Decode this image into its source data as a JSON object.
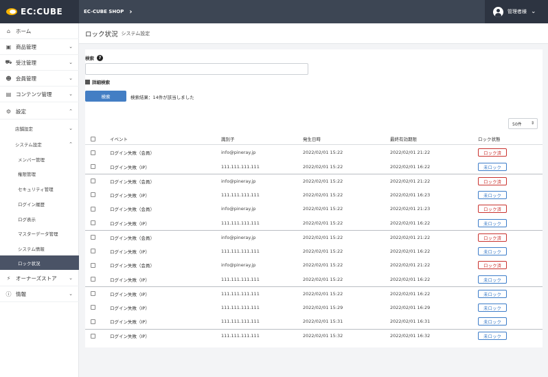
{
  "header": {
    "logo": "EC:CUBE",
    "shop_name": "EC-CUBE SHOP",
    "user_name": "管理者様"
  },
  "sidebar": {
    "items": [
      {
        "label": "ホーム",
        "icon": "home-icon"
      },
      {
        "label": "商品管理",
        "icon": "box-icon"
      },
      {
        "label": "受注管理",
        "icon": "cart-icon"
      },
      {
        "label": "会員管理",
        "icon": "users-icon"
      },
      {
        "label": "コンテンツ管理",
        "icon": "file-icon"
      },
      {
        "label": "設定",
        "icon": "gear-icon"
      },
      {
        "label": "オーナーズストア",
        "icon": "plug-icon"
      },
      {
        "label": "情報",
        "icon": "info-icon"
      }
    ],
    "settings_sub": [
      {
        "label": "店舗設定"
      },
      {
        "label": "システム設定"
      }
    ],
    "system_sub": [
      {
        "label": "メンバー管理"
      },
      {
        "label": "権限管理"
      },
      {
        "label": "セキュリティ管理"
      },
      {
        "label": "ログイン履歴"
      },
      {
        "label": "ログ表示"
      },
      {
        "label": "マスターデータ管理"
      },
      {
        "label": "システム情報"
      },
      {
        "label": "ロック状況"
      }
    ]
  },
  "page": {
    "title": "ロック状況",
    "subtitle": "システム設定"
  },
  "search": {
    "label": "検索",
    "input_value": "",
    "detail_label": "詳細検索",
    "button_label": "検索",
    "result_text": "検索結果：14件が該当しました"
  },
  "list": {
    "count_select": "50件",
    "headers": {
      "event": "イベント",
      "identifier": "識別子",
      "datetime": "発生日時",
      "last_auth": "最終有効期限",
      "status": "ロック状態"
    },
    "rows": [
      {
        "event": "ログイン失敗（会員）",
        "identifier": "info@pineray.jp",
        "datetime": "2022/02/01 15:22",
        "expire": "2022/02/01 21:22",
        "status": "ロック済",
        "locked": true,
        "grouptop": false
      },
      {
        "event": "ログイン失敗（IP）",
        "identifier": "111.111.111.111",
        "datetime": "2022/02/01 15:22",
        "expire": "2022/02/01 16:22",
        "status": "未ロック",
        "locked": false,
        "grouptop": false
      },
      {
        "event": "ログイン失敗（会員）",
        "identifier": "info@pineray.jp",
        "datetime": "2022/02/01 15:22",
        "expire": "2022/02/01 21:22",
        "status": "ロック済",
        "locked": true,
        "grouptop": true
      },
      {
        "event": "ログイン失敗（IP）",
        "identifier": "111.111.111.111",
        "datetime": "2022/02/01 15:22",
        "expire": "2022/02/01 16:23",
        "status": "未ロック",
        "locked": false,
        "grouptop": false
      },
      {
        "event": "ログイン失敗（会員）",
        "identifier": "info@pineray.jp",
        "datetime": "2022/02/01 15:22",
        "expire": "2022/02/01 21:23",
        "status": "ロック済",
        "locked": true,
        "grouptop": false
      },
      {
        "event": "ログイン失敗（IP）",
        "identifier": "111.111.111.111",
        "datetime": "2022/02/01 15:22",
        "expire": "2022/02/01 16:22",
        "status": "未ロック",
        "locked": false,
        "grouptop": false
      },
      {
        "event": "ログイン失敗（会員）",
        "identifier": "info@pineray.jp",
        "datetime": "2022/02/01 15:22",
        "expire": "2022/02/01 21:22",
        "status": "ロック済",
        "locked": true,
        "grouptop": true
      },
      {
        "event": "ログイン失敗（IP）",
        "identifier": "111.111.111.111",
        "datetime": "2022/02/01 15:22",
        "expire": "2022/02/01 16:22",
        "status": "未ロック",
        "locked": false,
        "grouptop": false
      },
      {
        "event": "ログイン失敗（会員）",
        "identifier": "info@pineray.jp",
        "datetime": "2022/02/01 15:22",
        "expire": "2022/02/01 21:22",
        "status": "ロック済",
        "locked": true,
        "grouptop": false
      },
      {
        "event": "ログイン失敗（IP）",
        "identifier": "111.111.111.111",
        "datetime": "2022/02/01 15:22",
        "expire": "2022/02/01 16:22",
        "status": "未ロック",
        "locked": false,
        "grouptop": false
      },
      {
        "event": "ログイン失敗（IP）",
        "identifier": "111.111.111.111",
        "datetime": "2022/02/01 15:22",
        "expire": "2022/02/01 16:22",
        "status": "未ロック",
        "locked": false,
        "grouptop": true
      },
      {
        "event": "ログイン失敗（IP）",
        "identifier": "111.111.111.111",
        "datetime": "2022/02/01 15:29",
        "expire": "2022/02/01 16:29",
        "status": "未ロック",
        "locked": false,
        "grouptop": false
      },
      {
        "event": "ログイン失敗（IP）",
        "identifier": "111.111.111.111",
        "datetime": "2022/02/01 15:31",
        "expire": "2022/02/01 16:31",
        "status": "未ロック",
        "locked": false,
        "grouptop": false
      },
      {
        "event": "ログイン失敗（IP）",
        "identifier": "111.111.111.111",
        "datetime": "2022/02/01 15:32",
        "expire": "2022/02/01 16:32",
        "status": "未ロック",
        "locked": false,
        "grouptop": true
      }
    ]
  }
}
